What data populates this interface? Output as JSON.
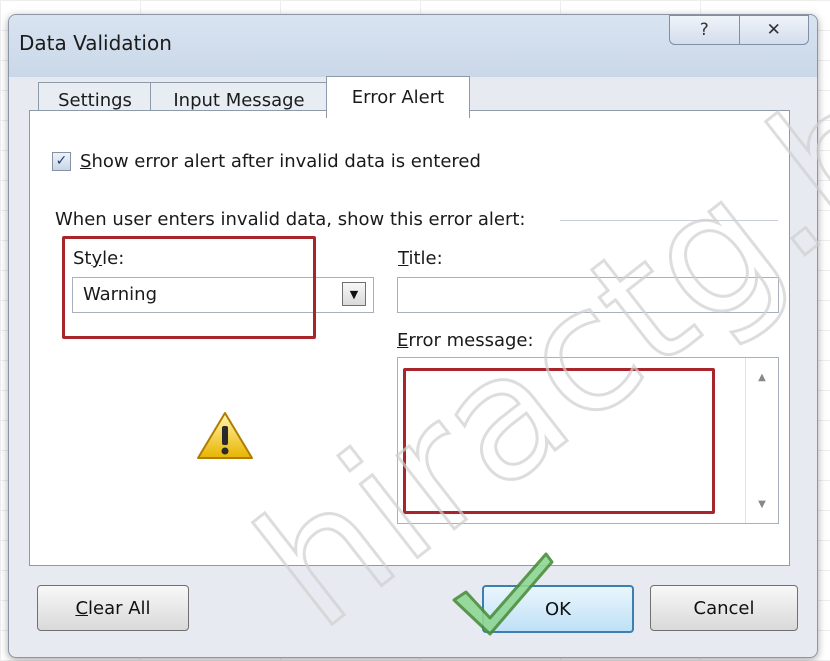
{
  "window": {
    "title": "Data Validation"
  },
  "titlebar_buttons": {
    "help": "?",
    "close": "✕"
  },
  "tabs": [
    {
      "label": "Settings",
      "active": false
    },
    {
      "label": "Input Message",
      "active": false
    },
    {
      "label": "Error Alert",
      "active": true
    }
  ],
  "show_error_alert": {
    "checked": true,
    "check_glyph": "✓",
    "label_hotkey": "S",
    "label_rest": "how error alert after invalid data is entered"
  },
  "section": {
    "label": "When user enters invalid data, show this error alert:"
  },
  "style": {
    "label_prefix": "St",
    "label_hotkey": "y",
    "label_suffix": "le:",
    "value": "Warning",
    "dropdown_glyph": "▼",
    "icon": "warning-triangle"
  },
  "title": {
    "label_hotkey": "T",
    "label_rest": "itle:",
    "value": ""
  },
  "error_message": {
    "label_hotkey": "E",
    "label_rest": "rror message:",
    "value": "",
    "scroll_up": "▲",
    "scroll_down": "▼"
  },
  "buttons": {
    "clear_hotkey": "C",
    "clear_rest": "lear All",
    "ok": "OK",
    "cancel": "Cancel"
  },
  "annotations": {
    "highlight_color": "#a8262b",
    "checkmark_color": "#4caf50"
  },
  "watermark": {
    "text": "hiractg.b",
    "color": "#cccccc"
  }
}
